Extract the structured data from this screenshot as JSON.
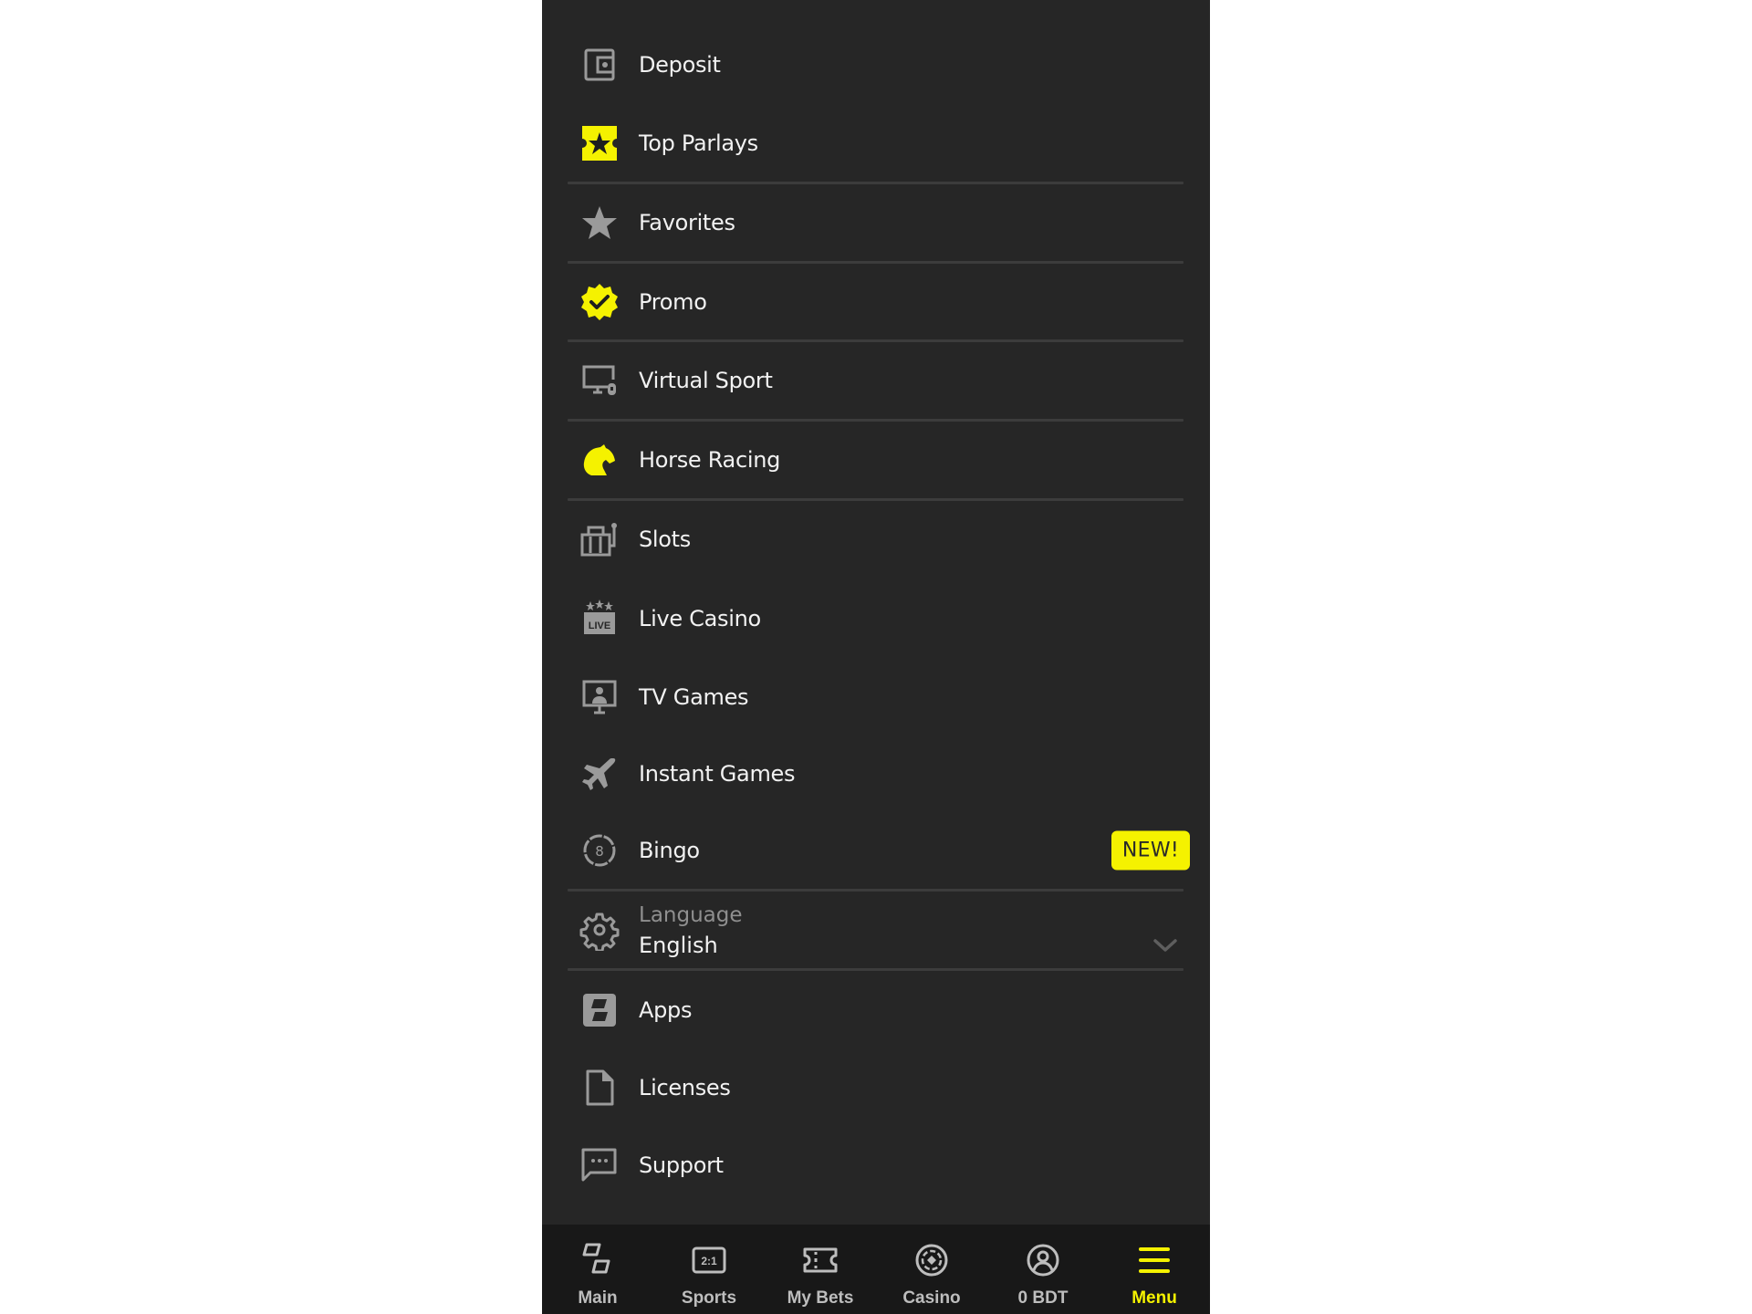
{
  "colors": {
    "panel_bg": "#262626",
    "nav_bg": "#181818",
    "accent_yellow": "#f5f200",
    "icon_gray": "#9a9a9a",
    "text_primary": "#f2f2f2",
    "text_secondary": "#8f8f8f"
  },
  "menu": {
    "items": [
      {
        "label": "Deposit",
        "icon": "wallet-icon"
      },
      {
        "label": "Top Parlays",
        "icon": "ticket-star-icon"
      },
      {
        "label": "Favorites",
        "icon": "star-icon"
      },
      {
        "label": "Promo",
        "icon": "verified-badge-icon"
      },
      {
        "label": "Virtual Sport",
        "icon": "monitor-controller-icon"
      },
      {
        "label": "Horse Racing",
        "icon": "horse-head-icon"
      },
      {
        "label": "Slots",
        "icon": "slot-machine-icon"
      },
      {
        "label": "Live Casino",
        "icon": "live-stars-icon"
      },
      {
        "label": "TV Games",
        "icon": "tv-presenter-icon"
      },
      {
        "label": "Instant Games",
        "icon": "airplane-icon"
      },
      {
        "label": "Bingo",
        "icon": "bingo-ball-icon",
        "badge": "NEW!"
      }
    ],
    "language": {
      "label": "Language",
      "value": "English",
      "icon": "gear-icon"
    },
    "footer_items": [
      {
        "label": "Apps",
        "icon": "apps-icon"
      },
      {
        "label": "Licenses",
        "icon": "document-icon"
      },
      {
        "label": "Support",
        "icon": "chat-icon"
      }
    ]
  },
  "bottom_nav": {
    "items": [
      {
        "label": "Main",
        "icon": "main-tiles-icon",
        "active": false
      },
      {
        "label": "Sports",
        "icon": "odds-icon",
        "active": false
      },
      {
        "label": "My Bets",
        "icon": "bet-ticket-icon",
        "active": false
      },
      {
        "label": "Casino",
        "icon": "casino-chip-icon",
        "active": false
      },
      {
        "label": "0 BDT",
        "icon": "user-account-icon",
        "active": false
      },
      {
        "label": "Menu",
        "icon": "hamburger-menu-icon",
        "active": true
      }
    ]
  }
}
